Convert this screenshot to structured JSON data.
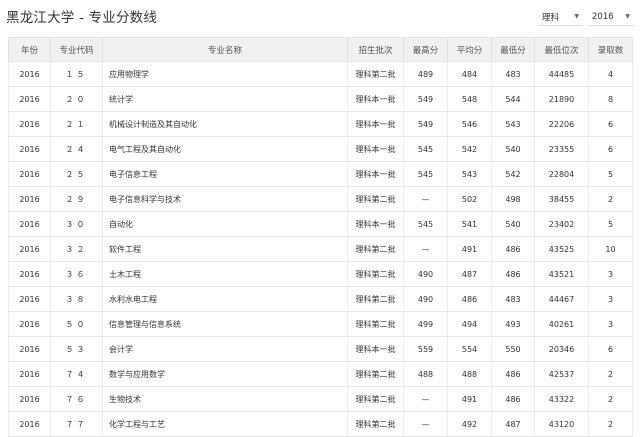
{
  "page": {
    "title": "黑龙江大学 - 专业分数线",
    "filters": {
      "type": "理科",
      "year": "2016"
    }
  },
  "table": {
    "headers": [
      "年份",
      "专业代码",
      "专业名称",
      "招生批次",
      "最高分",
      "平均分",
      "最低分",
      "最低位次",
      "录取数"
    ],
    "rows": [
      [
        "2016",
        "１５",
        "应用物理学",
        "理科第二批",
        "489",
        "484",
        "483",
        "44485",
        "4"
      ],
      [
        "2016",
        "２０",
        "统计学",
        "理科本一批",
        "549",
        "548",
        "544",
        "21890",
        "8"
      ],
      [
        "2016",
        "２１",
        "机械设计制造及其自动化",
        "理科本一批",
        "549",
        "546",
        "543",
        "22206",
        "6"
      ],
      [
        "2016",
        "２４",
        "电气工程及其自动化",
        "理科本一批",
        "545",
        "542",
        "540",
        "23355",
        "6"
      ],
      [
        "2016",
        "２５",
        "电子信息工程",
        "理科本一批",
        "545",
        "543",
        "542",
        "22804",
        "5"
      ],
      [
        "2016",
        "２９",
        "电子信息科学与技术",
        "理科第二批",
        "—",
        "502",
        "498",
        "38455",
        "2"
      ],
      [
        "2016",
        "３０",
        "自动化",
        "理科本一批",
        "545",
        "541",
        "540",
        "23402",
        "5"
      ],
      [
        "2016",
        "３２",
        "软件工程",
        "理科第二批",
        "—",
        "491",
        "486",
        "43525",
        "10"
      ],
      [
        "2016",
        "３６",
        "土木工程",
        "理科第二批",
        "490",
        "487",
        "486",
        "43521",
        "3"
      ],
      [
        "2016",
        "３８",
        "水利水电工程",
        "理科第二批",
        "490",
        "486",
        "483",
        "44467",
        "3"
      ],
      [
        "2016",
        "５０",
        "信息管理与信息系统",
        "理科第二批",
        "499",
        "494",
        "493",
        "40261",
        "3"
      ],
      [
        "2016",
        "５３",
        "会计学",
        "理科本一批",
        "559",
        "554",
        "550",
        "20346",
        "6"
      ],
      [
        "2016",
        "７４",
        "数学与应用数学",
        "理科第二批",
        "488",
        "488",
        "486",
        "42537",
        "2"
      ],
      [
        "2016",
        "７６",
        "生物技术",
        "理科第二批",
        "—",
        "491",
        "486",
        "43322",
        "2"
      ],
      [
        "2016",
        "７７",
        "化学工程与工艺",
        "理科第二批",
        "—",
        "492",
        "487",
        "43120",
        "2"
      ]
    ]
  }
}
